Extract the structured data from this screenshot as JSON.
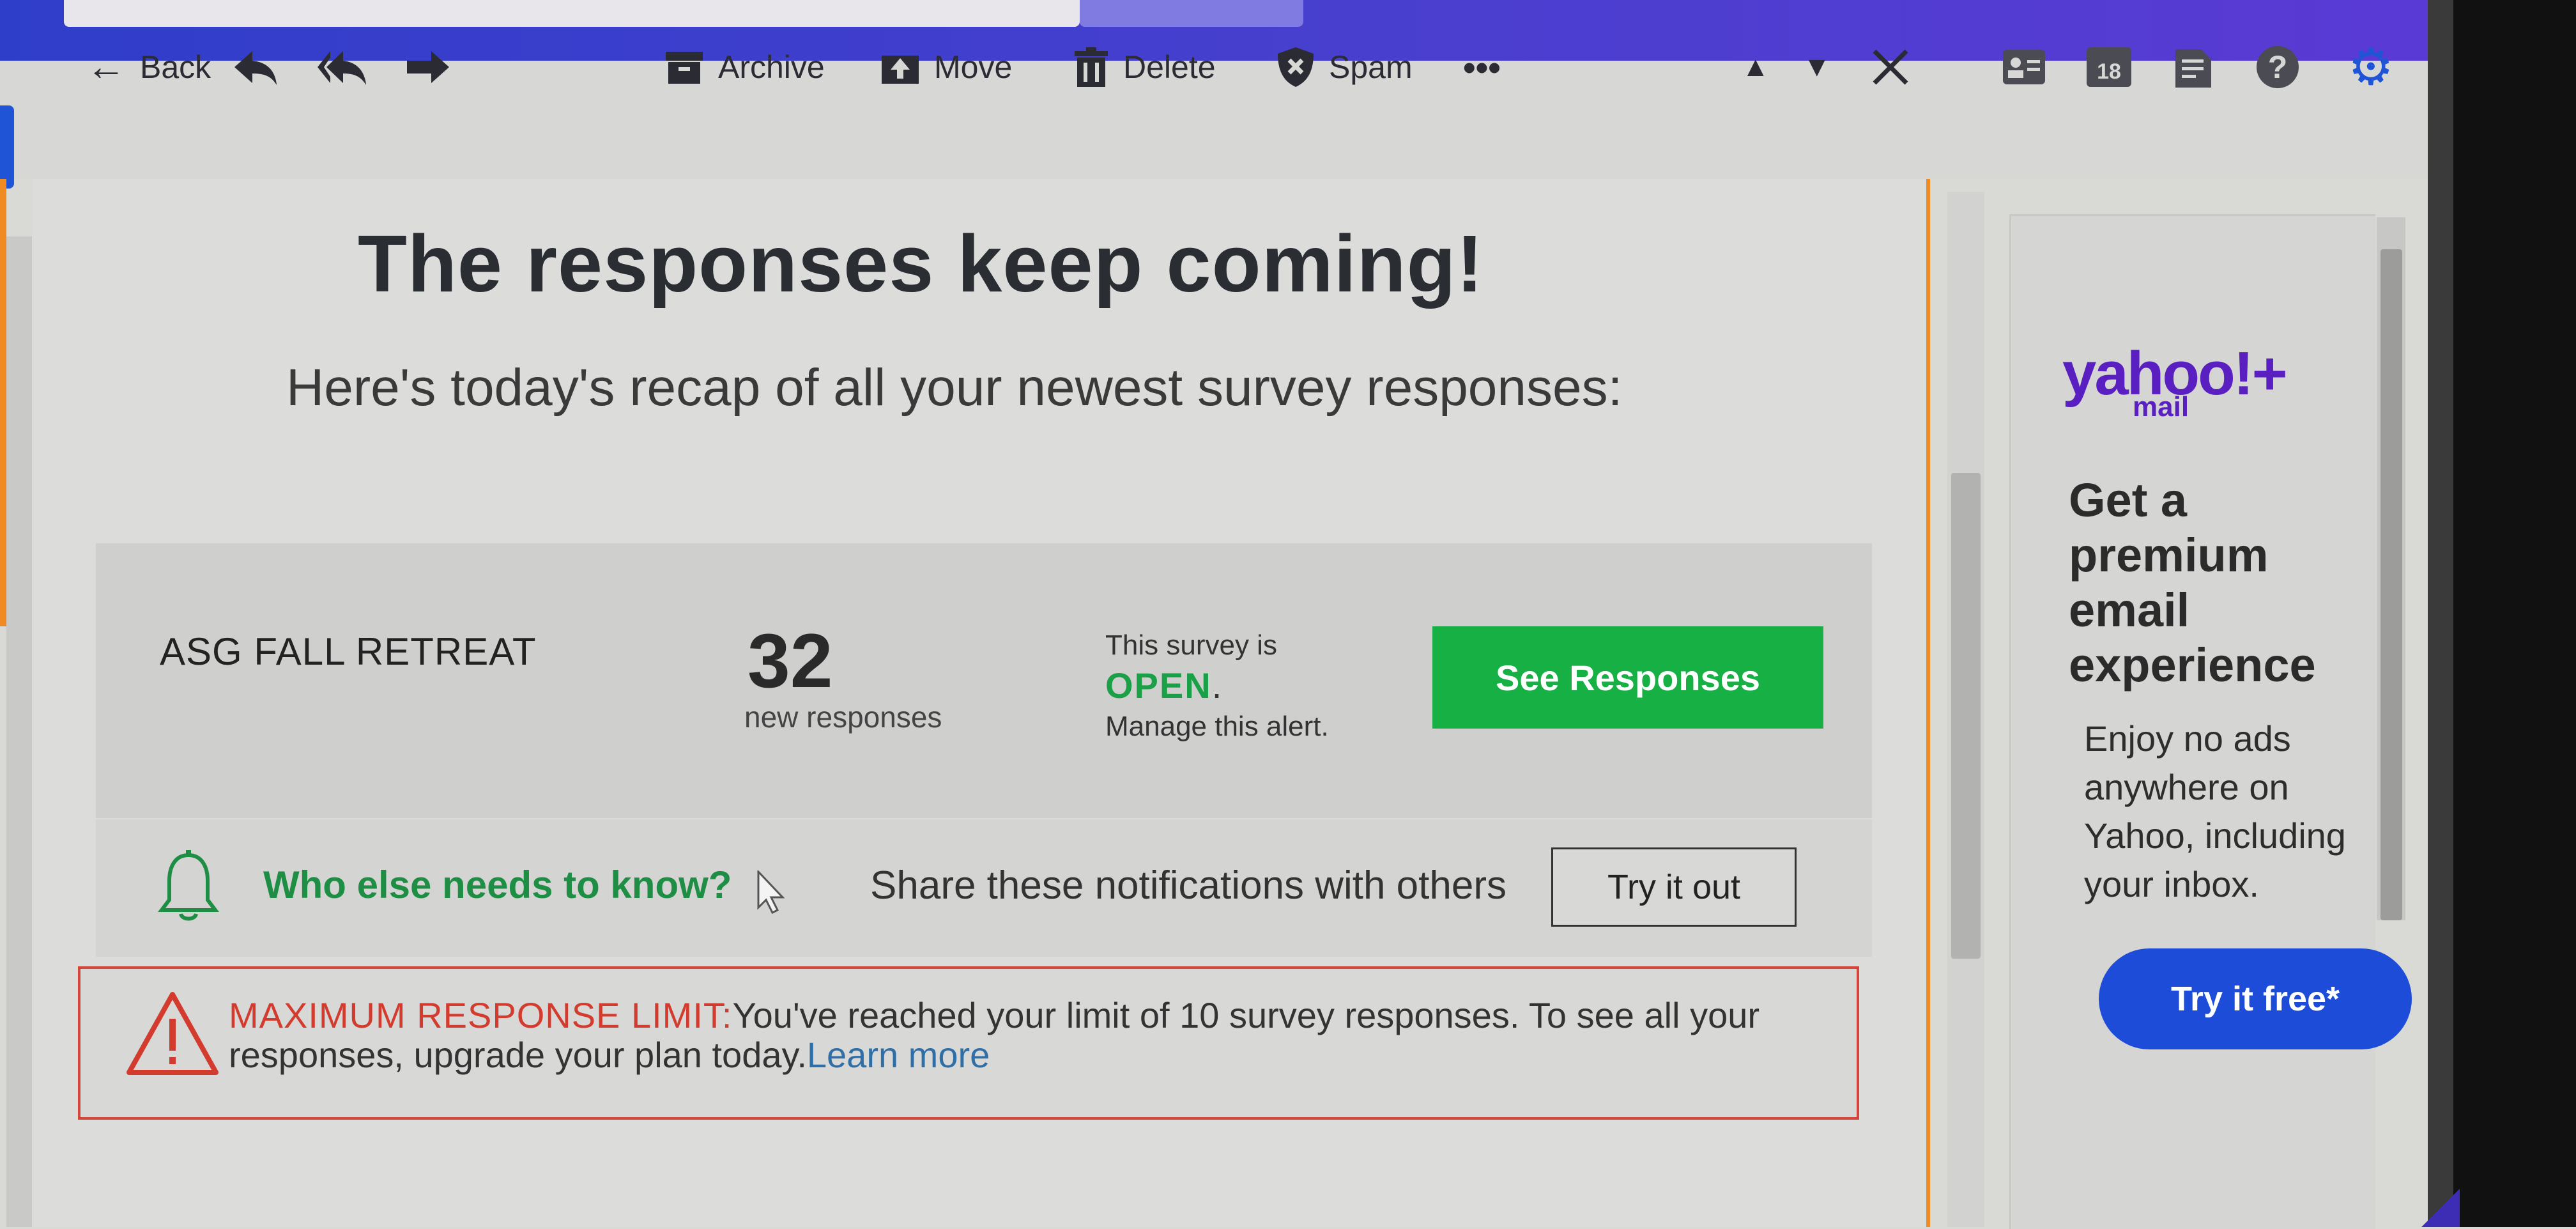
{
  "toolbar": {
    "back_label": "Back",
    "archive_label": "Archive",
    "move_label": "Move",
    "delete_label": "Delete",
    "spam_label": "Spam",
    "more_label": "•••",
    "calendar_day": "18"
  },
  "email": {
    "heading": "The responses keep coming!",
    "subheading": "Here's today's recap of all your newest survey responses:",
    "survey": {
      "name": "ASG FALL RETREAT",
      "count": "32",
      "count_label": "new responses",
      "status_prefix": "This survey is",
      "status": "OPEN",
      "status_suffix": ".",
      "manage_link": "Manage this alert.",
      "see_button": "See Responses"
    },
    "share": {
      "question": "Who else needs to know?",
      "text": "Share these notifications with others",
      "button": "Try it out"
    },
    "alert": {
      "title": "MAXIMUM RESPONSE LIMIT:",
      "message": "You've reached your limit of 10 survey responses. To see all your responses, upgrade your plan today.",
      "link": "Learn more"
    }
  },
  "ad": {
    "brand": "yahoo!+",
    "brand_sub": "mail",
    "headline": "Get a premium email experience",
    "body": "Enjoy no ads anywhere on Yahoo, including your inbox.",
    "cta": "Try it free*"
  },
  "colors": {
    "accent_green": "#16b045",
    "alert_red": "#d23b2e",
    "brand_purple": "#5a1fc0",
    "cta_blue": "#1d4dd8"
  }
}
